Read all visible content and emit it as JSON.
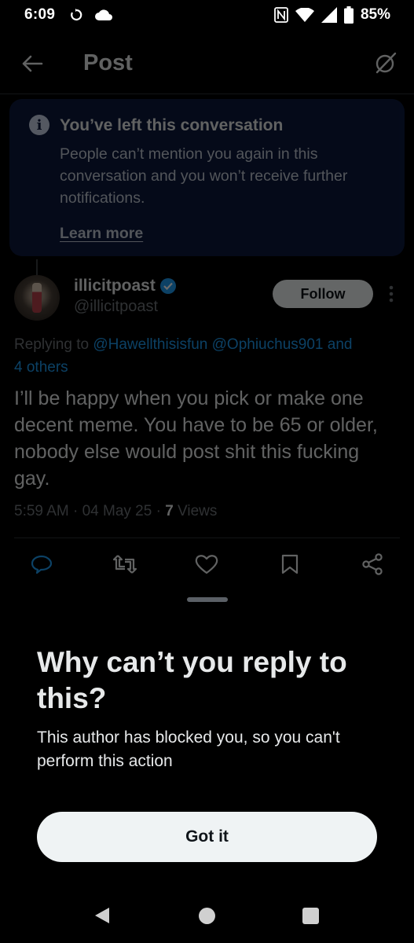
{
  "status_bar": {
    "time": "6:09",
    "battery": "85%",
    "icons": [
      "sync-icon",
      "cloud-icon",
      "nfc-icon",
      "wifi-icon",
      "signal-icon",
      "battery-icon"
    ]
  },
  "header": {
    "title": "Post"
  },
  "notice": {
    "title": "You’ve left this conversation",
    "body": "People can’t mention you again in this conversation and you won’t receive further notifications.",
    "link": "Learn more"
  },
  "post": {
    "author_name": "illicitpoast",
    "author_handle": "@illicitpoast",
    "follow_label": "Follow",
    "replying_prefix": "Replying to",
    "replying_mention_1": "@Hawellthisisfun",
    "replying_mention_2": "@Ophiuchus901",
    "replying_and": "and",
    "replying_others": "4 others",
    "text": "I’ll be happy when you pick or make one decent meme. You have to be 65 or older, nobody else would post shit this fucking gay.",
    "timestamp": "5:59 AM · 04 May 25 · ",
    "views_count": "7",
    "views_label": " Views"
  },
  "sheet": {
    "title": "Why can’t you reply to this?",
    "body": "This author has blocked you, so you can't perform this action",
    "button": "Got it"
  },
  "colors": {
    "background": "#000000",
    "accent": "#1d9bf0",
    "notice_bg": "#0d1a3d",
    "muted_text": "#71767b"
  }
}
